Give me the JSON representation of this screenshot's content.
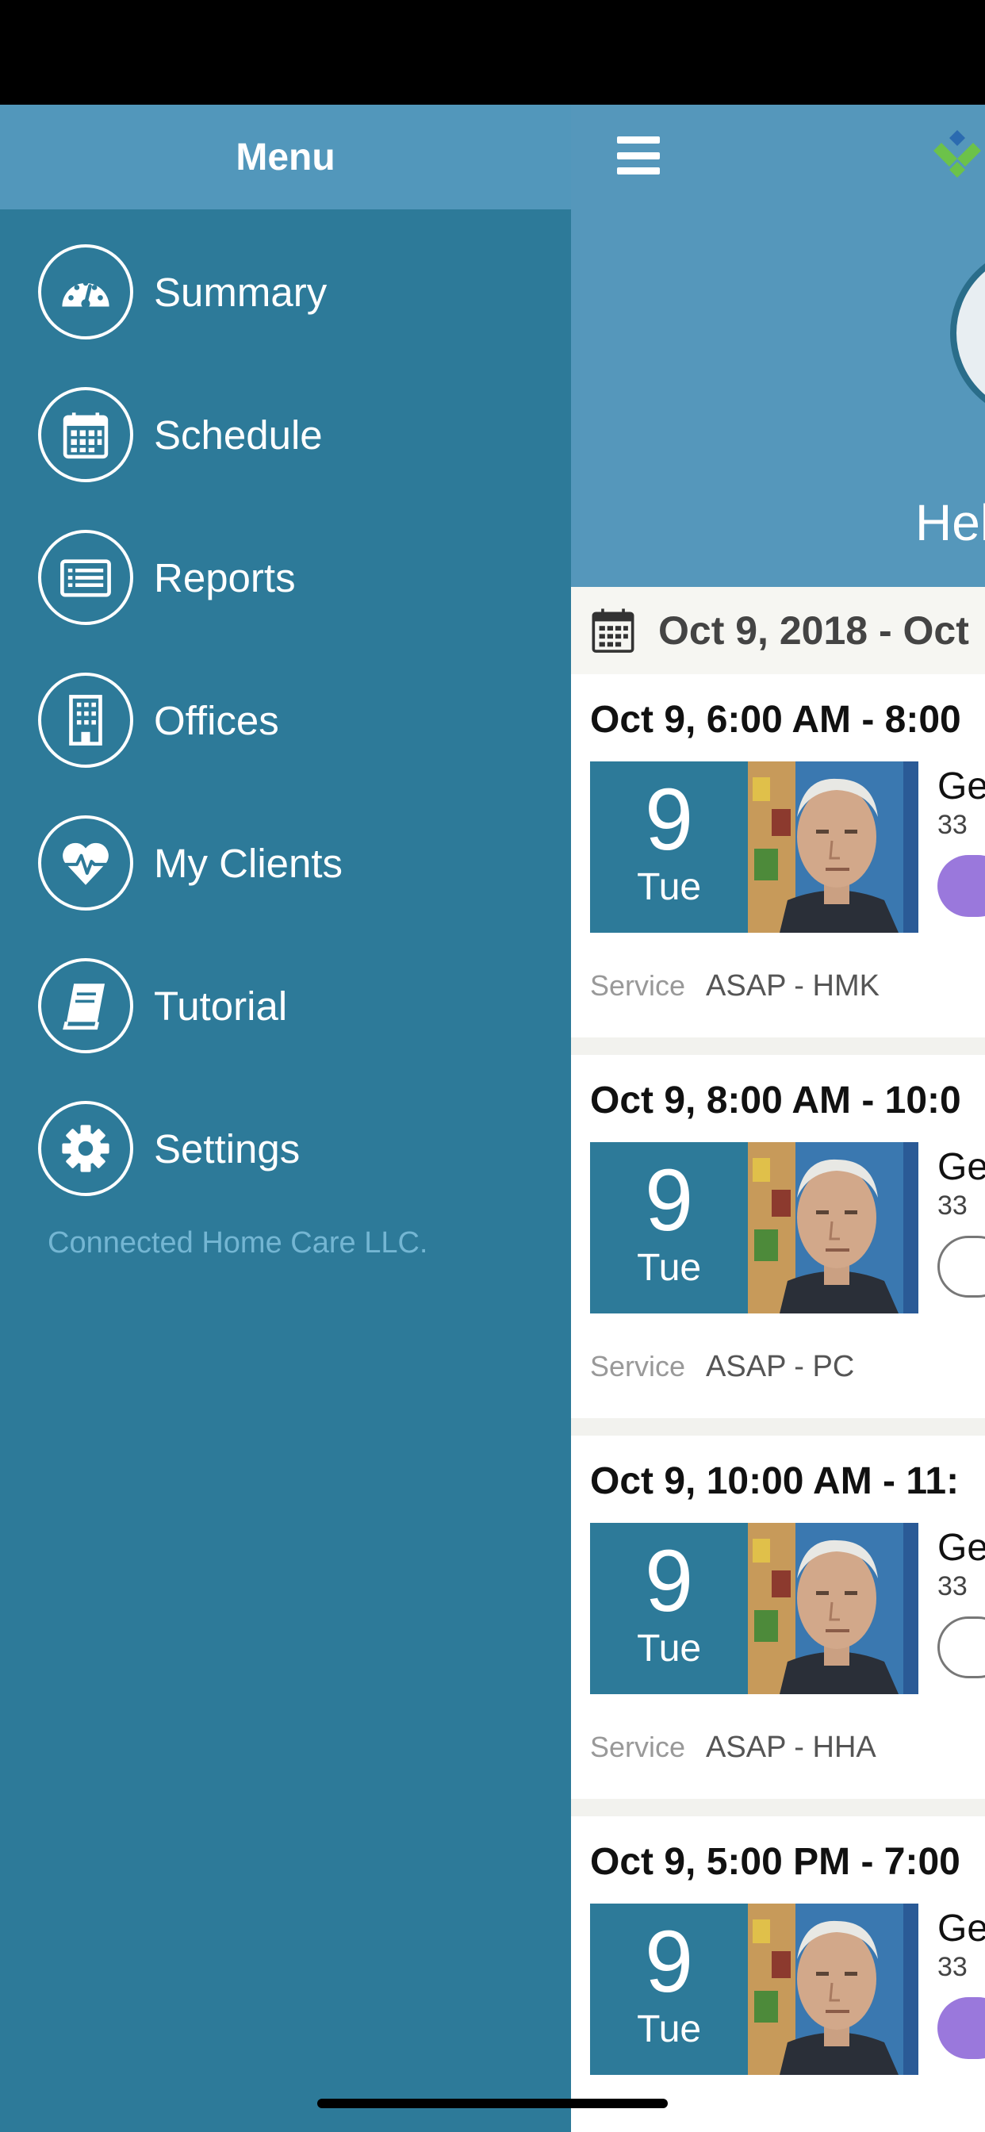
{
  "menu": {
    "title": "Menu",
    "items": [
      {
        "label": "Summary",
        "icon": "dashboard-gauge-icon"
      },
      {
        "label": "Schedule",
        "icon": "calendar-icon"
      },
      {
        "label": "Reports",
        "icon": "report-list-icon"
      },
      {
        "label": "Offices",
        "icon": "office-building-icon"
      },
      {
        "label": "My Clients",
        "icon": "heart-pulse-icon"
      },
      {
        "label": "Tutorial",
        "icon": "book-icon"
      },
      {
        "label": "Settings",
        "icon": "gear-icon"
      }
    ],
    "footer": "Connected Home Care LLC."
  },
  "main": {
    "greeting": "Hel",
    "date_range": "Oct 9, 2018 - Oct",
    "visits": [
      {
        "time": "Oct 9, 6:00 AM - 8:00",
        "day_num": "9",
        "day_name": "Tue",
        "client": "Ge",
        "sub": "33",
        "status": "filled",
        "service_label": "Service",
        "service": "ASAP - HMK"
      },
      {
        "time": "Oct 9, 8:00 AM - 10:0",
        "day_num": "9",
        "day_name": "Tue",
        "client": "Ge",
        "sub": "33",
        "status": "outline",
        "service_label": "Service",
        "service": "ASAP - PC"
      },
      {
        "time": "Oct 9, 10:00 AM - 11:",
        "day_num": "9",
        "day_name": "Tue",
        "client": "Ge",
        "sub": "33",
        "status": "outline",
        "service_label": "Service",
        "service": "ASAP - HHA"
      },
      {
        "time": "Oct 9, 5:00 PM - 7:00",
        "day_num": "9",
        "day_name": "Tue",
        "client": "Ge",
        "sub": "33",
        "status": "filled",
        "service_label": "",
        "service": ""
      }
    ]
  },
  "colors": {
    "menu_bg": "#2d7a99",
    "menu_header_bg": "#5297bb",
    "main_header_bg": "#5597bb",
    "status_filled": "#9a78dc",
    "footer_text": "#74b6d3"
  }
}
